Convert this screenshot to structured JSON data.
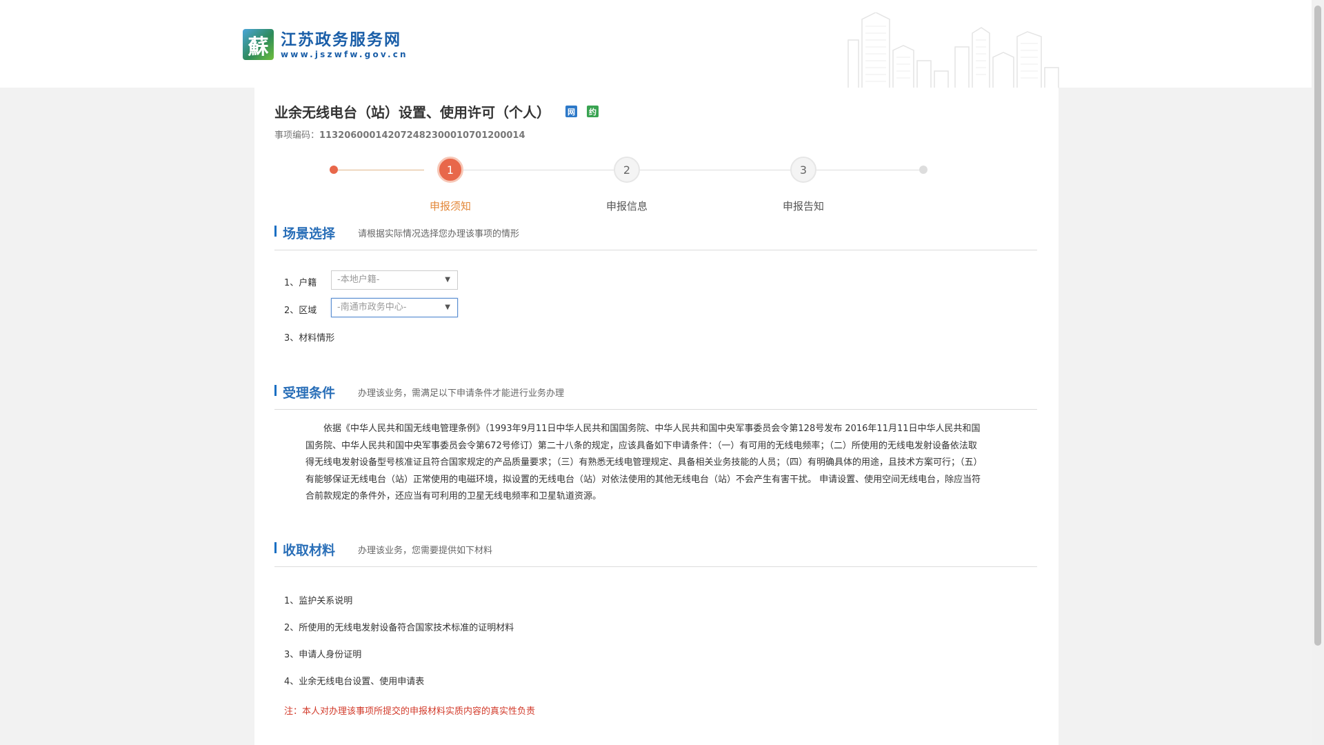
{
  "site": {
    "logo_char": "蘇",
    "name": "江苏政务服务网",
    "url": "www.jszwfw.gov.cn"
  },
  "item": {
    "title": "业余无线电台（站）设置、使用许可（个人）",
    "tag_net": "网",
    "tag_appointment": "约",
    "code_label": "事项编码：",
    "code_value": "11320600014207248230001070120001​4"
  },
  "steps": [
    {
      "number": "1",
      "label": "申报须知",
      "active": true
    },
    {
      "number": "2",
      "label": "申报信息",
      "active": false
    },
    {
      "number": "3",
      "label": "申报告知",
      "active": false
    }
  ],
  "scene": {
    "title": "场景选择",
    "desc": "请根据实际情况选择您办理该事项的情形",
    "fields": [
      {
        "label": "1、户籍",
        "value": "-本地户籍-"
      },
      {
        "label": "2、区域",
        "value": "-南通市政务中心-"
      },
      {
        "label": "3、材料情形"
      }
    ]
  },
  "conditions": {
    "title": "受理条件",
    "desc": "办理该业务，需满足以下申请条件才能进行业务办理",
    "text": "依据《中华人民共和国无线电管理条例》（1993年9月11日中华人民共和国国务院、中华人民共和国中央军事委员会令第128号发布 2016年11月11日中华人民共和国国务院、中华人民共和国中央军事委员会令第672号修订）第二十八条的规定，应该具备如下申请条件：（一）有可用的无线电频率；（二）所使用的无线电发射设备依法取得无线电发射设备型号核准证且符合国家规定的产品质量要求；（三）有熟悉无线电管理规定、具备相关业务技能的人员；（四）有明确具体的用途，且技术方案可行；（五）有能够保证无线电台（站）正常使用的电磁环境，拟设置的无线电台（站）对依法使用的其他无线电台（站）不会产生有害干扰。 申请设置、使用空间无线电台，除应当符合前款规定的条件外，还应当有可利用的卫星无线电频率和卫星轨道资源。"
  },
  "materials": {
    "title": "收取材料",
    "desc": "办理该业务，您需要提供如下材料",
    "items": [
      "1、监护关系说明",
      "2、所使用的无线电发射设备符合国家技术标准的证明材料",
      "3、申请人身份证明",
      "4、业余无线电台设置、使用申请表"
    ],
    "note": "注：本人对办理该事项所提交的申报材料实质内容的真实性负责"
  },
  "colors": {
    "accent": "#e8674a",
    "brand": "#1a5ea8",
    "section_title": "#2a6fb8",
    "note": "#d23a2a"
  }
}
